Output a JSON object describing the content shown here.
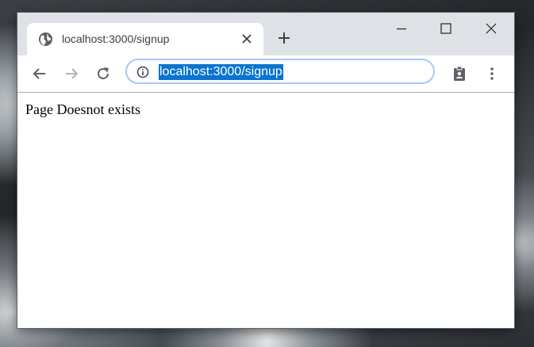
{
  "tab": {
    "title": "localhost:3000/signup",
    "favicon": "globe-icon"
  },
  "toolbar": {
    "address": "localhost:3000/signup",
    "selection_color": "#0a74d0"
  },
  "page": {
    "message": "Page Doesnot exists"
  }
}
